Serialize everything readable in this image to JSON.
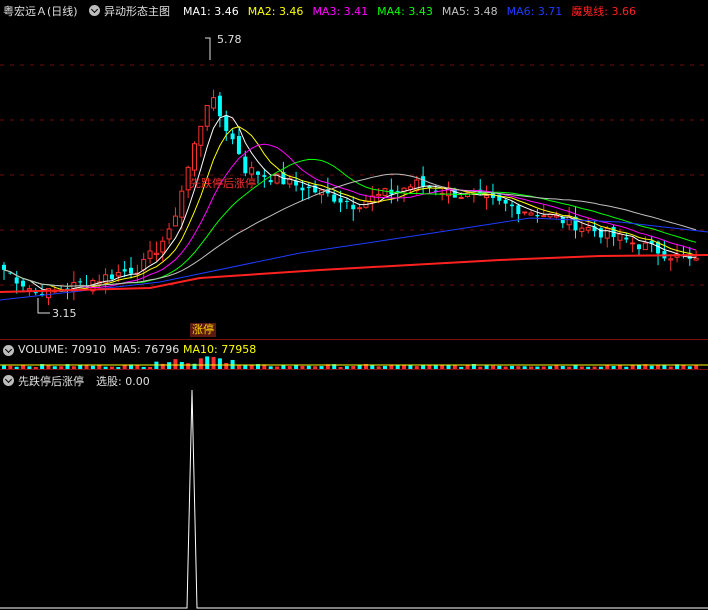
{
  "main": {
    "stock_title": "粤宏远Ａ(日线)",
    "indicator_name": "异动形态主图",
    "ma": [
      {
        "label": "MA1:",
        "value": "3.46",
        "color": "#ffffff"
      },
      {
        "label": "MA2:",
        "value": "3.46",
        "color": "#ffff00"
      },
      {
        "label": "MA3:",
        "value": "3.41",
        "color": "#ff00ff"
      },
      {
        "label": "MA4:",
        "value": "3.43",
        "color": "#00ff00"
      },
      {
        "label": "MA5:",
        "value": "3.48",
        "color": "#c0c0c0"
      },
      {
        "label": "MA6:",
        "value": "3.71",
        "color": "#1e3cff"
      },
      {
        "label": "魔鬼线:",
        "value": "3.66",
        "color": "#ff2020"
      }
    ],
    "high_label": "5.78",
    "low_label": "3.15",
    "signal_text": "先跌停后涨停",
    "zhangting_tag": "涨停"
  },
  "volume": {
    "label": "VOLUME:",
    "value": "70910",
    "ma5_label": "MA5:",
    "ma5_value": "76796",
    "ma10_label": "MA10:",
    "ma10_value": "77958"
  },
  "signal": {
    "name": "先跌停后涨停",
    "select_label": "选股:",
    "select_value": "0.00"
  },
  "colors": {
    "up": "#ff3030",
    "down": "#00ffff",
    "ma1": "#ffffff",
    "ma2": "#ffff00",
    "ma3": "#ff00ff",
    "ma4": "#00ff00",
    "ma5": "#c0c0c0",
    "ma6": "#1e3cff",
    "devil": "#ff2020"
  }
}
